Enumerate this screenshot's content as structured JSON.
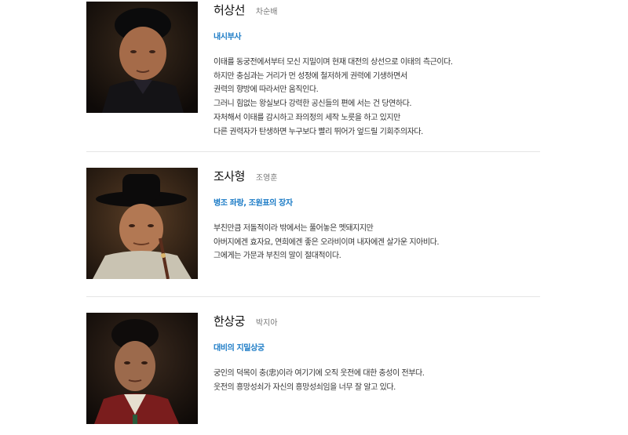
{
  "cast": [
    {
      "name": "허상선",
      "actor": "차순배",
      "role": "내시부사",
      "description": [
        "이태를 동궁전에서부터 모신 지밀이며 현재 대전의 상선으로 이태의 측근이다.",
        "하지만 충심과는 거리가 먼 성정에 철저하게 권력에 기생하면서",
        "권력의 향방에 따라서만 움직인다.",
        "그러니 힘없는 왕실보다 강력한 공신들의 편에 서는 건 당연하다.",
        "자처해서 이태를 감시하고 좌의정의 세작 노릇을 하고 있지만",
        "다른 권력자가 탄생하면 누구보다 빨리 뛰어가 엎드릴 기회주의자다."
      ]
    },
    {
      "name": "조사형",
      "actor": "조영훈",
      "role": "병조 좌랑, 조원표의 장자",
      "description": [
        "부친만큼 저돌적이라 밖에서는 풀어놓은 멧돼지지만",
        "아버지에겐 효자요, 연희에겐 좋은 오라비이며 내자에겐 살가운 지아비다.",
        "그에게는 가문과 부친의 말이 절대적이다."
      ]
    },
    {
      "name": "한상궁",
      "actor": "박지아",
      "role": "대비의 지밀상궁",
      "description": [
        "궁인의 덕목이 충(忠)이라 여기기에 오직 웃전에 대한 충성이 전부다.",
        "웃전의 흥망성쇠가 자신의 흥망성쇠임을 너무 잘 알고 있다."
      ]
    }
  ]
}
